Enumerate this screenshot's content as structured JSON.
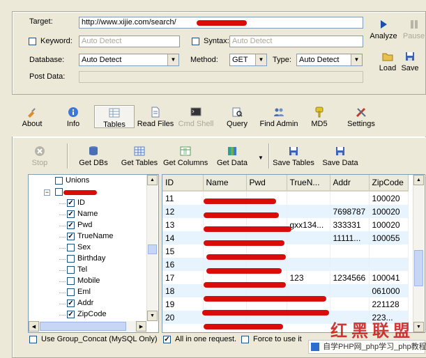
{
  "form": {
    "target_label": "Target:",
    "target_value": "http://www.xijie.com/search/",
    "keyword_label": "Keyword:",
    "keyword_value": "Auto Detect",
    "syntax_label": "Syntax:",
    "syntax_value": "Auto Detect",
    "database_label": "Database:",
    "database_value": "Auto Detect",
    "method_label": "Method:",
    "method_value": "GET",
    "type_label": "Type:",
    "type_value": "Auto Detect",
    "post_data_label": "Post Data:",
    "post_data_value": ""
  },
  "side_buttons": {
    "analyze": "Analyze",
    "pause": "Pause",
    "load": "Load",
    "save": "Save"
  },
  "main_toolbar": [
    {
      "label": "About",
      "icon": "syringe-icon",
      "disabled": false,
      "active": false
    },
    {
      "label": "Info",
      "icon": "info-icon",
      "disabled": false,
      "active": false
    },
    {
      "label": "Tables",
      "icon": "tables-icon",
      "disabled": false,
      "active": true
    },
    {
      "label": "Read Files",
      "icon": "document-icon",
      "disabled": false,
      "active": false
    },
    {
      "label": "Cmd Shell",
      "icon": "terminal-icon",
      "disabled": true,
      "active": false
    },
    {
      "label": "Query",
      "icon": "query-icon",
      "disabled": false,
      "active": false
    },
    {
      "label": "Find Admin",
      "icon": "users-icon",
      "disabled": false,
      "active": false
    },
    {
      "label": "MD5",
      "icon": "key-icon",
      "disabled": false,
      "active": false
    },
    {
      "label": "Settings",
      "icon": "settings-icon",
      "disabled": false,
      "active": false
    }
  ],
  "sub_toolbar": [
    {
      "label": "Stop",
      "icon": "stop-icon",
      "disabled": true
    },
    {
      "label": "Get DBs",
      "icon": "database-icon",
      "disabled": false
    },
    {
      "label": "Get Tables",
      "icon": "grid-icon",
      "disabled": false
    },
    {
      "label": "Get Columns",
      "icon": "columns-icon",
      "disabled": false
    },
    {
      "label": "Get Data",
      "icon": "data-icon",
      "disabled": false
    },
    {
      "label": "Save Tables",
      "icon": "floppy-icon",
      "disabled": false
    },
    {
      "label": "Save Data",
      "icon": "floppy-icon",
      "disabled": false
    }
  ],
  "tree": [
    {
      "label": "Unions",
      "checked": false,
      "level": 1,
      "expander": false
    },
    {
      "label": "",
      "checked": false,
      "level": 1,
      "expander": true,
      "redacted": true
    },
    {
      "label": "ID",
      "checked": true,
      "level": 2
    },
    {
      "label": "Name",
      "checked": true,
      "level": 2
    },
    {
      "label": "Pwd",
      "checked": true,
      "level": 2
    },
    {
      "label": "TrueName",
      "checked": true,
      "level": 2
    },
    {
      "label": "Sex",
      "checked": false,
      "level": 2
    },
    {
      "label": "Birthday",
      "checked": false,
      "level": 2
    },
    {
      "label": "Tel",
      "checked": false,
      "level": 2
    },
    {
      "label": "Mobile",
      "checked": false,
      "level": 2
    },
    {
      "label": "Eml",
      "checked": false,
      "level": 2
    },
    {
      "label": "Addr",
      "checked": true,
      "level": 2
    },
    {
      "label": "ZipCode",
      "checked": true,
      "level": 2
    }
  ],
  "grid": {
    "columns": [
      "ID",
      "Name",
      "Pwd",
      "TrueN...",
      "Addr",
      "ZipCode"
    ],
    "rows": [
      [
        "11",
        "",
        "",
        "",
        "",
        "100020"
      ],
      [
        "12",
        "",
        "",
        "",
        "7698787",
        "100020"
      ],
      [
        "13",
        "",
        "",
        "gxx134...",
        "333331",
        "100020"
      ],
      [
        "14",
        "",
        "",
        "",
        "11111...",
        "100055"
      ],
      [
        "15",
        "",
        "",
        "",
        "",
        ""
      ],
      [
        "16",
        "",
        "",
        "",
        "",
        ""
      ],
      [
        "17",
        "",
        "",
        "123",
        "1234566",
        "100041"
      ],
      [
        "18",
        "",
        "",
        "",
        "",
        "061000"
      ],
      [
        "19",
        "",
        "",
        "",
        "",
        "221128"
      ],
      [
        "20",
        "",
        "",
        "",
        "",
        "223..."
      ]
    ]
  },
  "bottom_options": {
    "group_concat": "Use Group_Concat (MySQL Only)",
    "all_in_one": "All in one request.",
    "force": "Force to use it"
  },
  "watermark": {
    "cn_big": "红黑联盟",
    "php_text": "自学PHP网_php学习_php教程"
  },
  "colors": {
    "window_bg": "#ece9d8",
    "redaction": "#d90b0b",
    "alt_row": "#e7f3fd"
  }
}
